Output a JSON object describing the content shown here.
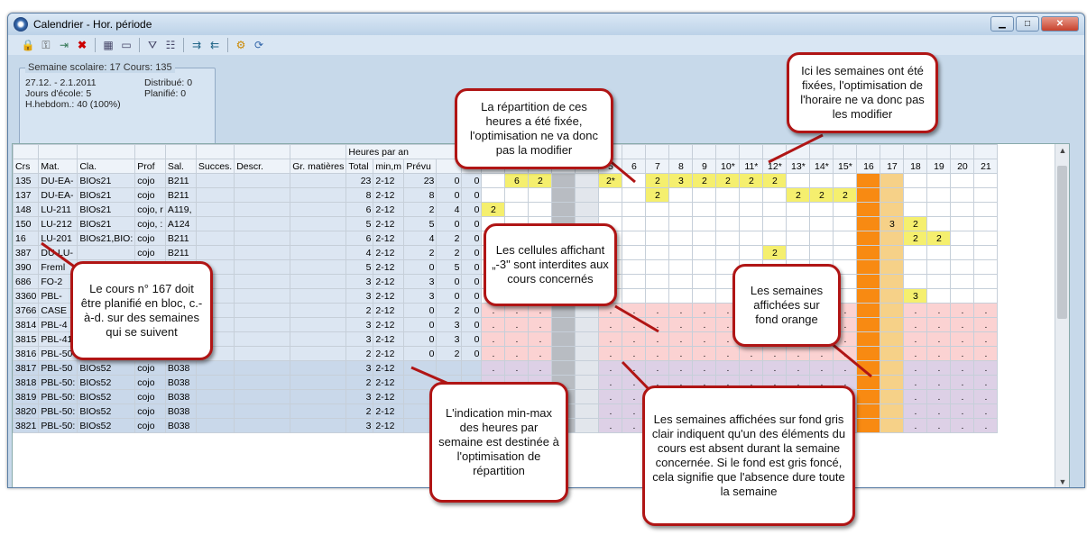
{
  "window": {
    "title": "Calendrier - Hor. période",
    "colors": {
      "frame": "#c7d9ea",
      "accent": "#b01515",
      "yellow": "#f5ef6e",
      "orange": "#f88a12",
      "pink": "#fbd2d2"
    }
  },
  "toolbar": {
    "icons": [
      "lock-icon",
      "key-icon",
      "forward-icon",
      "delete-icon",
      "calculator-icon",
      "tool-icon",
      "filter-icon",
      "settings-icon",
      "export-icon",
      "import-icon",
      "gear-icon",
      "refresh-icon"
    ]
  },
  "info_panel": {
    "legend": "Semaine scolaire: 17  Cours: 135",
    "dates": "27.12. - 2.1.2011",
    "school_days": "Jours d'école: 5",
    "weekly_hours": "H.hebdom.: 40 (100%)",
    "distributed": "Distribué: 0",
    "planned": "Planifié: 0"
  },
  "table": {
    "group_header": "Heures par an",
    "headers": [
      "Crs",
      "Mat.",
      "Cla.",
      "Prof",
      "Sal.",
      "Succes.",
      "Descr.",
      "Gr. matières",
      "Total",
      "min,m",
      "Prévu"
    ],
    "week_headers": [
      "5",
      "6",
      "7",
      "8",
      "9",
      "10*",
      "11*",
      "12*",
      "13*",
      "14*",
      "15*",
      "16",
      "17",
      "18",
      "19",
      "20",
      "21"
    ],
    "rows": [
      {
        "crs": "135",
        "mat": "DU-EA-",
        "cla": "BIOs21",
        "prof": "cojo",
        "sal": "B211",
        "total": "23",
        "minmax": "2-12",
        "prevu": "23",
        "c1": "0",
        "c2": "0"
      },
      {
        "crs": "137",
        "mat": "DU-EA-",
        "cla": "BIOs21",
        "prof": "cojo",
        "sal": "B211",
        "total": "8",
        "minmax": "2-12",
        "prevu": "8",
        "c1": "0",
        "c2": "0"
      },
      {
        "crs": "148",
        "mat": "LU-211",
        "cla": "BIOs21",
        "prof": "cojo, r",
        "sal": "A119,",
        "total": "6",
        "minmax": "2-12",
        "prevu": "2",
        "c1": "4",
        "c2": "0"
      },
      {
        "crs": "150",
        "mat": "LU-212",
        "cla": "BIOs21",
        "prof": "cojo, :",
        "sal": "A124",
        "total": "5",
        "minmax": "2-12",
        "prevu": "5",
        "c1": "0",
        "c2": "0"
      },
      {
        "crs": "16",
        "mat": "LU-201",
        "cla": "BIOs21,BIO:",
        "prof": "cojo",
        "sal": "B211",
        "total": "6",
        "minmax": "2-12",
        "prevu": "4",
        "c1": "2",
        "c2": "0"
      },
      {
        "crs": "387",
        "mat": "DU-LU-",
        "cla": "",
        "prof": "cojo",
        "sal": "B211",
        "total": "4",
        "minmax": "2-12",
        "prevu": "2",
        "c1": "2",
        "c2": "0"
      },
      {
        "crs": "390",
        "mat": "Freml",
        "cla": "",
        "prof": "",
        "sal": "",
        "total": "5",
        "minmax": "2-12",
        "prevu": "0",
        "c1": "5",
        "c2": "0"
      },
      {
        "crs": "686",
        "mat": "FO-2",
        "cla": "",
        "prof": "",
        "sal": "",
        "total": "3",
        "minmax": "2-12",
        "prevu": "3",
        "c1": "0",
        "c2": "0"
      },
      {
        "crs": "3360",
        "mat": "PBL-",
        "cla": "",
        "prof": "",
        "sal": "",
        "total": "3",
        "minmax": "2-12",
        "prevu": "3",
        "c1": "0",
        "c2": "0"
      },
      {
        "crs": "3766",
        "mat": "CASE",
        "cla": "",
        "prof": "",
        "sal": "",
        "total": "2",
        "minmax": "2-12",
        "prevu": "0",
        "c1": "2",
        "c2": "0"
      },
      {
        "crs": "3814",
        "mat": "PBL-4",
        "cla": "",
        "prof": "",
        "sal": "",
        "total": "3",
        "minmax": "2-12",
        "prevu": "0",
        "c1": "3",
        "c2": "0"
      },
      {
        "crs": "3815",
        "mat": "PBL-41:",
        "cla": "BIOs52",
        "prof": "cojo",
        "sal": "B038",
        "total": "3",
        "minmax": "2-12",
        "prevu": "0",
        "c1": "3",
        "c2": "0"
      },
      {
        "crs": "3816",
        "mat": "PBL-50",
        "cla": "BIOs52",
        "prof": "cojo",
        "sal": "B038",
        "total": "2",
        "minmax": "2-12",
        "prevu": "0",
        "c1": "2",
        "c2": "0"
      },
      {
        "crs": "3817",
        "mat": "PBL-50",
        "cla": "BIOs52",
        "prof": "cojo",
        "sal": "B038",
        "total": "3",
        "minmax": "2-12",
        "prevu": "",
        "c1": "",
        "c2": ""
      },
      {
        "crs": "3818",
        "mat": "PBL-50:",
        "cla": "BIOs52",
        "prof": "cojo",
        "sal": "B038",
        "total": "2",
        "minmax": "2-12",
        "prevu": "",
        "c1": "",
        "c2": ""
      },
      {
        "crs": "3819",
        "mat": "PBL-50:",
        "cla": "BIOs52",
        "prof": "cojo",
        "sal": "B038",
        "total": "3",
        "minmax": "2-12",
        "prevu": "",
        "c1": "",
        "c2": ""
      },
      {
        "crs": "3820",
        "mat": "PBL-50:",
        "cla": "BIOs52",
        "prof": "cojo",
        "sal": "B038",
        "total": "2",
        "minmax": "2-12",
        "prevu": "",
        "c1": "",
        "c2": ""
      },
      {
        "crs": "3821",
        "mat": "PBL-50:",
        "cla": "BIOs52",
        "prof": "cojo",
        "sal": "B038",
        "total": "3",
        "minmax": "2-12",
        "prevu": "",
        "c1": "",
        "c2": ""
      }
    ],
    "week_cells": [
      [
        "",
        "6",
        "2",
        "",
        "",
        "2*",
        "",
        "2",
        "3",
        "2",
        "2",
        "2",
        "2",
        "",
        "",
        "",
        "",
        "",
        "",
        "",
        "",
        ""
      ],
      [
        "",
        "",
        "",
        "",
        "",
        "",
        "",
        "2",
        "",
        "",
        "",
        "",
        "",
        "2",
        "2",
        "2",
        "",
        "",
        "",
        "",
        "",
        ""
      ],
      [
        "2",
        "",
        "",
        "",
        "",
        "",
        "",
        "",
        "",
        "",
        "",
        "",
        "",
        "",
        "",
        "",
        "",
        "",
        "",
        "",
        "",
        ""
      ],
      [
        "",
        "",
        "",
        "",
        "",
        "",
        "",
        "",
        "",
        "",
        "",
        "",
        "",
        "",
        "",
        "",
        "",
        "3",
        "2",
        "",
        "",
        ""
      ],
      [
        "",
        "",
        "",
        "",
        "",
        "",
        "",
        "",
        "",
        "",
        "",
        "",
        "",
        "",
        "",
        "",
        "",
        "",
        "2",
        "2",
        "",
        ""
      ],
      [
        "",
        "",
        "",
        "",
        "",
        "",
        "",
        "",
        "",
        "",
        "",
        "",
        "2",
        "",
        "",
        "",
        "",
        "",
        "",
        "",
        "",
        ""
      ],
      [
        "",
        "",
        "",
        "",
        "",
        "",
        "",
        "",
        "",
        "",
        "",
        "",
        "",
        "",
        "",
        "",
        "",
        "",
        "",
        "",
        "",
        ""
      ],
      [
        "",
        "",
        "",
        "",
        "",
        "",
        "",
        "",
        "",
        "",
        "",
        "",
        "",
        "",
        "",
        "",
        "",
        "",
        "",
        "",
        "",
        ""
      ],
      [
        "",
        "",
        "",
        "",
        "",
        "",
        "",
        "",
        "",
        "",
        "",
        "",
        "",
        "",
        "",
        "",
        "",
        "",
        "3",
        "",
        "",
        ""
      ],
      [
        ".",
        ".",
        ".",
        "",
        "",
        ".",
        ".",
        ".",
        ".",
        ".",
        ".",
        ".",
        ".",
        ".",
        ".",
        ".",
        "",
        "",
        ".",
        ".",
        ".",
        "."
      ],
      [
        ".",
        ".",
        ".",
        "",
        "",
        ".",
        ".",
        ".",
        ".",
        ".",
        ".",
        ".",
        ".",
        ".",
        ".",
        ".",
        "",
        "",
        ".",
        ".",
        ".",
        "."
      ],
      [
        ".",
        ".",
        ".",
        "",
        "",
        ".",
        ".",
        ".",
        ".",
        ".",
        ".",
        ".",
        ".",
        ".",
        ".",
        ".",
        "",
        "",
        ".",
        ".",
        ".",
        "."
      ],
      [
        ".",
        ".",
        ".",
        "",
        "",
        ".",
        ".",
        ".",
        ".",
        ".",
        ".",
        ".",
        ".",
        ".",
        ".",
        ".",
        "",
        "",
        ".",
        ".",
        ".",
        "."
      ],
      [
        ".",
        ".",
        ".",
        "",
        "",
        ".",
        ".",
        ".",
        ".",
        ".",
        ".",
        ".",
        ".",
        ".",
        ".",
        ".",
        "",
        "",
        ".",
        ".",
        ".",
        "."
      ],
      [
        ".",
        ".",
        ".",
        "",
        "",
        ".",
        ".",
        ".",
        ".",
        ".",
        ".",
        ".",
        ".",
        ".",
        ".",
        ".",
        "",
        "",
        ".",
        ".",
        ".",
        "."
      ],
      [
        ".",
        ".",
        ".",
        "",
        "",
        ".",
        ".",
        ".",
        ".",
        ".",
        ".",
        ".",
        ".",
        ".",
        ".",
        ".",
        "",
        "",
        ".",
        ".",
        ".",
        "."
      ],
      [
        ".",
        ".",
        ".",
        "",
        "",
        ".",
        ".",
        ".",
        ".",
        ".",
        ".",
        ".",
        ".",
        ".",
        ".",
        ".",
        "",
        "",
        ".",
        ".",
        ".",
        "."
      ],
      [
        ".",
        ".",
        ".",
        "",
        "",
        ".",
        ".",
        ".",
        ".",
        ".",
        ".",
        ".",
        ".",
        ".",
        ".",
        ".",
        "",
        "",
        ".",
        ".",
        ".",
        "."
      ]
    ]
  },
  "callouts": [
    {
      "id": "fixed-distribution",
      "text": "La répartition de ces heures a été fixée, l'optimisation ne va donc pas la modifier"
    },
    {
      "id": "fixed-weeks",
      "text": "Ici les semaines ont été fixées, l'optimisation de l'horaire ne va donc pas les modifier"
    },
    {
      "id": "block-course",
      "text": "Le cours n° 167 doit être planifié en bloc, c.-à-d. sur des semaines qui se suivent"
    },
    {
      "id": "forbidden-cells",
      "text": "Les cellules affichant „-3\" sont interdites aux cours concernés"
    },
    {
      "id": "orange-weeks",
      "text": "Les semaines affichées sur fond orange"
    },
    {
      "id": "minmax-info",
      "text": "L'indication min-max des heures par semaine est destinée à l'optimisation de répartition"
    },
    {
      "id": "grey-weeks",
      "text": "Les semaines affichées sur fond gris clair indiquent qu'un des éléments du cours est absent durant la semaine concernée. Si le fond est gris foncé, cela signifie que l'absence dure toute la semaine"
    }
  ]
}
